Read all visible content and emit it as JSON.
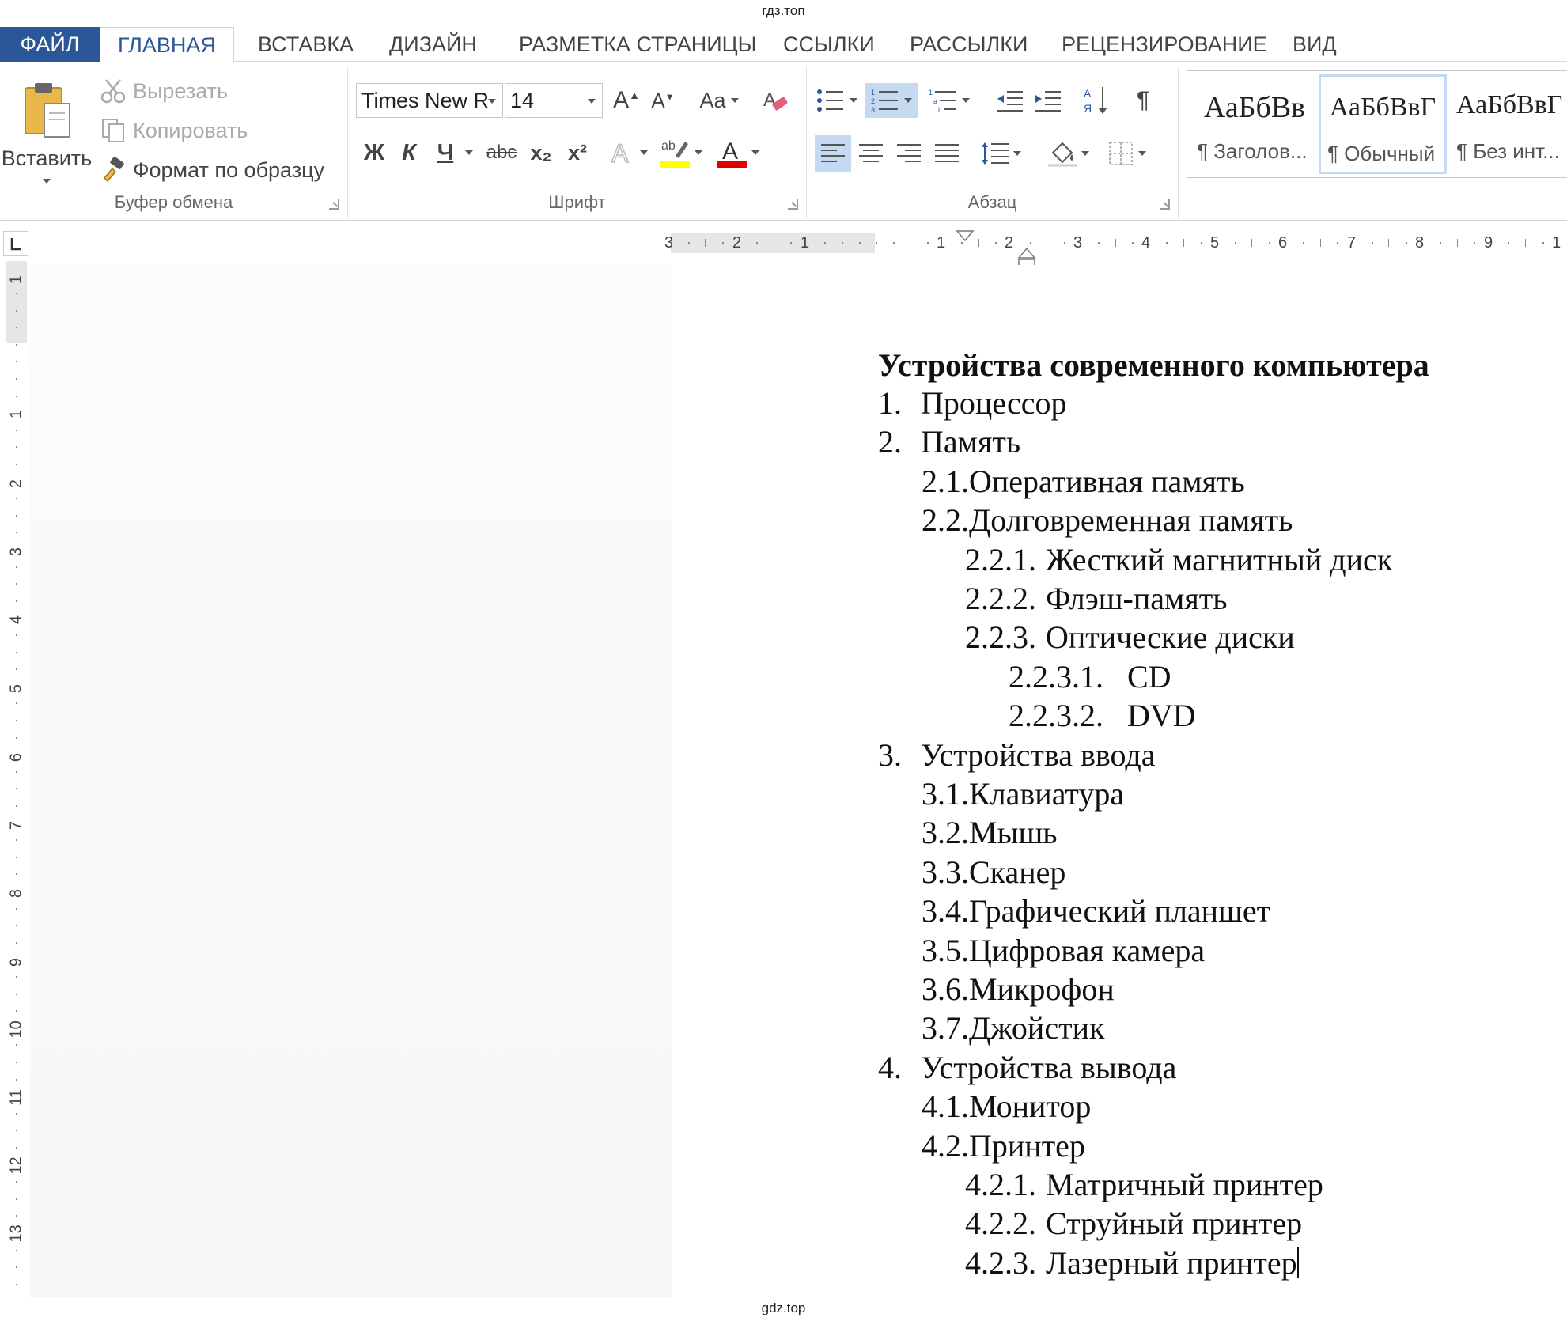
{
  "watermark": {
    "top": "гдз.топ",
    "bottom": "gdz.top"
  },
  "tabs": {
    "file": "ФАЙЛ",
    "home": "ГЛАВНАЯ",
    "insert": "ВСТАВКА",
    "design": "ДИЗАЙН",
    "layout": "РАЗМЕТКА СТРАНИЦЫ",
    "references": "ССЫЛКИ",
    "mailings": "РАССЫЛКИ",
    "review": "РЕЦЕНЗИРОВАНИЕ",
    "view": "ВИД"
  },
  "clipboard": {
    "paste": "Вставить",
    "cut": "Вырезать",
    "copy": "Копировать",
    "format_painter": "Формат по образцу",
    "label": "Буфер обмена"
  },
  "font": {
    "name": "Times New R",
    "size": "14",
    "case": "Aa",
    "bold": "Ж",
    "italic": "К",
    "underline": "Ч",
    "strike": "abc",
    "subscript": "x₂",
    "superscript": "x²",
    "label": "Шрифт"
  },
  "paragraph": {
    "label": "Абзац"
  },
  "styles": [
    {
      "preview": "АаБбВв",
      "name": "¶ Заголов..."
    },
    {
      "preview": "АаБбВвГ",
      "name": "¶ Обычный"
    },
    {
      "preview": "АаБбВвГ",
      "name": "¶ Без инт..."
    }
  ],
  "colors": {
    "accent": "#2b579a",
    "highlight": "#ffff00",
    "font_color": "#e00000",
    "selected": "#c5d9f1"
  },
  "ruler": {
    "horizontal": [
      "3",
      "2",
      "1",
      "1",
      "2",
      "3",
      "4",
      "5",
      "6",
      "7",
      "8",
      "9",
      "1"
    ],
    "vertical": [
      "1",
      "1",
      "2",
      "3",
      "4",
      "5",
      "6",
      "7",
      "8",
      "9",
      "10",
      "11",
      "12",
      "13"
    ]
  },
  "document": {
    "title": "Устройства современного компьютера",
    "items": [
      {
        "num": "1.",
        "text": "Процессор",
        "level": 1
      },
      {
        "num": "2.",
        "text": "Память",
        "level": 1
      },
      {
        "num": "2.1.",
        "text": "Оперативная память",
        "level": 2
      },
      {
        "num": "2.2.",
        "text": "Долговременная память",
        "level": 2
      },
      {
        "num": "2.2.1.",
        "text": "Жесткий магнитный диск",
        "level": 3
      },
      {
        "num": "2.2.2.",
        "text": "Флэш-память",
        "level": 3
      },
      {
        "num": "2.2.3.",
        "text": "Оптические диски",
        "level": 3
      },
      {
        "num": "2.2.3.1.",
        "text": "CD",
        "level": 4
      },
      {
        "num": "2.2.3.2.",
        "text": "DVD",
        "level": 4
      },
      {
        "num": "3.",
        "text": "Устройства ввода",
        "level": 1
      },
      {
        "num": "3.1.",
        "text": "Клавиатура",
        "level": 2
      },
      {
        "num": "3.2.",
        "text": "Мышь",
        "level": 2
      },
      {
        "num": "3.3.",
        "text": "Сканер",
        "level": 2
      },
      {
        "num": "3.4.",
        "text": "Графический планшет",
        "level": 2
      },
      {
        "num": "3.5.",
        "text": "Цифровая камера",
        "level": 2
      },
      {
        "num": "3.6.",
        "text": "Микрофон",
        "level": 2
      },
      {
        "num": "3.7.",
        "text": "Джойстик",
        "level": 2
      },
      {
        "num": "4.",
        "text": "Устройства вывода",
        "level": 1
      },
      {
        "num": "4.1.",
        "text": "Монитор",
        "level": 2
      },
      {
        "num": "4.2.",
        "text": "Принтер",
        "level": 2
      },
      {
        "num": "4.2.1.",
        "text": "Матричный принтер",
        "level": 3
      },
      {
        "num": "4.2.2.",
        "text": "Струйный принтер",
        "level": 3
      },
      {
        "num": "4.2.3.",
        "text": "Лазерный принтер",
        "level": 3
      }
    ]
  }
}
